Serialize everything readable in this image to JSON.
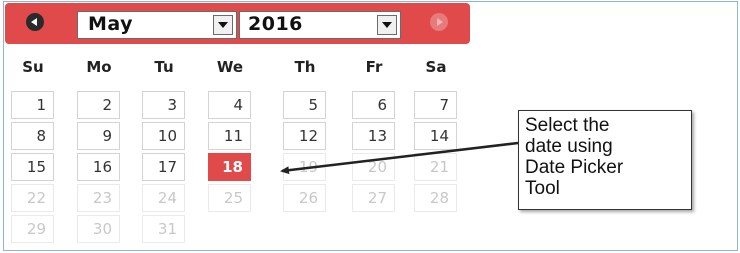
{
  "datepicker": {
    "month": "May",
    "year": "2016",
    "weekdays": [
      "Su",
      "Mo",
      "Tu",
      "We",
      "Th",
      "Fr",
      "Sa"
    ],
    "days": [
      [
        "1",
        "2",
        "3",
        "4",
        "5",
        "6",
        "7"
      ],
      [
        "8",
        "9",
        "10",
        "11",
        "12",
        "13",
        "14"
      ],
      [
        "15",
        "16",
        "17",
        "18",
        "19",
        "20",
        "21"
      ],
      [
        "22",
        "23",
        "24",
        "25",
        "26",
        "27",
        "28"
      ],
      [
        "29",
        "30",
        "31"
      ]
    ],
    "selected_day": "18",
    "accent_color": "#e04a4a"
  },
  "callout": {
    "lines": [
      "Select the",
      "date using",
      "Date Picker",
      "Tool"
    ]
  }
}
